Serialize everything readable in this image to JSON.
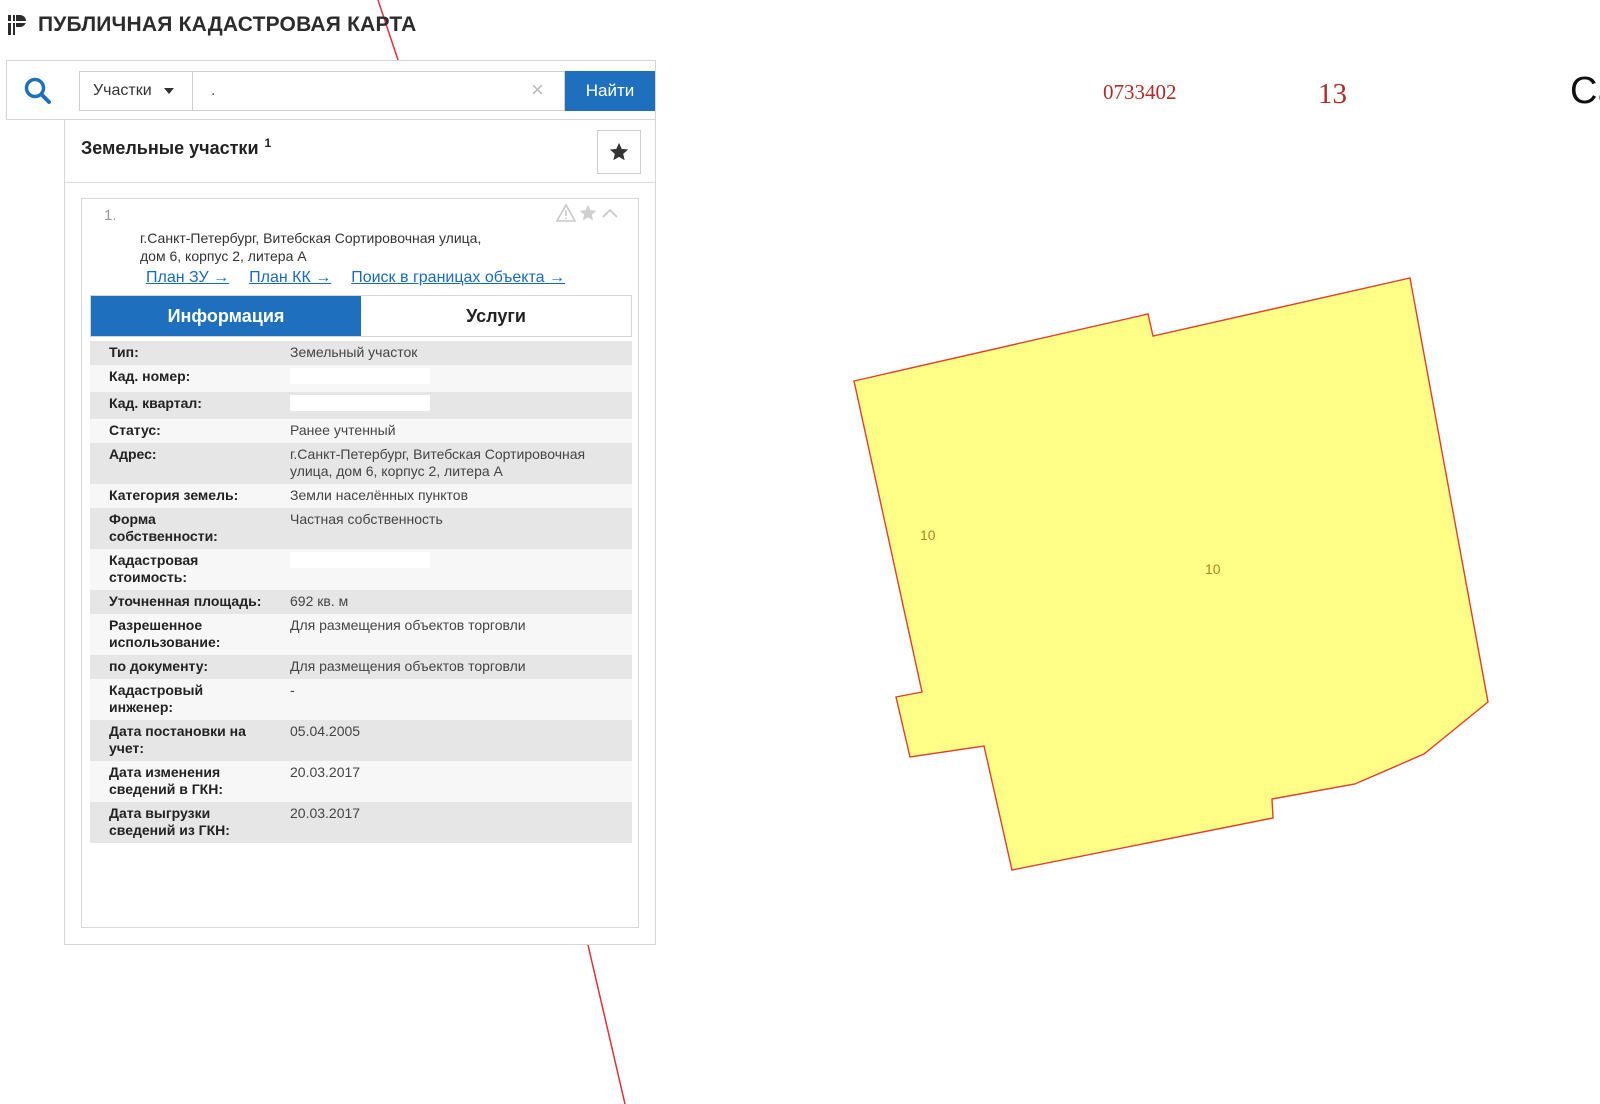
{
  "app": {
    "title": "ПУБЛИЧНАЯ КАДАСТРОВАЯ КАРТА"
  },
  "search": {
    "type_value": "Участки",
    "query_value": ".",
    "button_label": "Найти"
  },
  "panel": {
    "title": "Земельные участки",
    "count": "1"
  },
  "result": {
    "index": "1.",
    "address": "г.Санкт-Петербург, Витебская Сортировочная улица, дом 6, корпус 2, литера А",
    "links": [
      "План ЗУ →",
      "План КК →",
      "Поиск в границах объекта →"
    ],
    "tabs": {
      "info": "Информация",
      "services": "Услуги"
    },
    "fields": [
      {
        "key": "Тип:",
        "value": "Земельный участок"
      },
      {
        "key": "Кад. номер:",
        "value": ""
      },
      {
        "key": "Кад. квартал:",
        "value": ""
      },
      {
        "key": "Статус:",
        "value": "Ранее учтенный"
      },
      {
        "key": "Адрес:",
        "value": "г.Санкт-Петербург, Витебская Сортировочная улица, дом 6, корпус 2, литера А"
      },
      {
        "key": "Категория земель:",
        "value": "Земли населённых пунктов"
      },
      {
        "key": "Форма собственности:",
        "value": "Частная собственность"
      },
      {
        "key": "Кадастровая стоимость:",
        "value": ""
      },
      {
        "key": "Уточненная площадь:",
        "value": "692 кв. м"
      },
      {
        "key": "Разрешенное использование:",
        "value": "Для размещения объектов торговли"
      },
      {
        "key": "по документу:",
        "value": "Для размещения объектов торговли"
      },
      {
        "key": "Кадастровый инженер:",
        "value": "-"
      },
      {
        "key": "Дата постановки на учет:",
        "value": "05.04.2005"
      },
      {
        "key": "Дата изменения сведений в ГКН:",
        "value": "20.03.2017"
      },
      {
        "key": "Дата выгрузки сведений из ГКН:",
        "value": "20.03.2017"
      }
    ]
  },
  "map": {
    "quarter_label": "0733402",
    "block_label": "13",
    "edge_label": "Са",
    "parcel_numbers": [
      "10",
      "10"
    ]
  },
  "colors": {
    "accent": "#1f6fbf",
    "parcel_fill": "#ffff88",
    "parcel_stroke": "#e0402a",
    "boundary_line": "#e0303a"
  }
}
